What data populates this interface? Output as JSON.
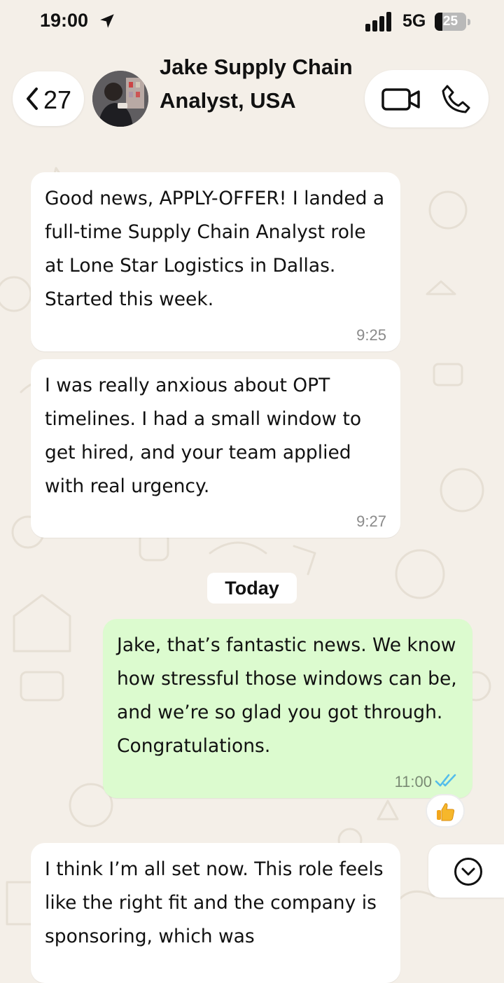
{
  "status_bar": {
    "time": "19:00",
    "network": "5G",
    "battery_level": "25",
    "battery_fraction": 0.25
  },
  "header": {
    "back_count": "27",
    "contact_name": "Jake Supply Chain Analyst, USA"
  },
  "messages": [
    {
      "direction": "incoming",
      "text": "Good news, APPLY-OFFER! I landed a full-time Supply Chain Analyst role at Lone Star Logistics in Dallas. Started this week.",
      "time": "9:25"
    },
    {
      "direction": "incoming",
      "text": "I was really anxious about OPT timelines. I had a small window to get hired, and your team applied with real urgency.",
      "time": "9:27"
    },
    {
      "direction": "outgoing",
      "text": "Jake, that’s fantastic news. We know how stressful those windows can be, and we’re so glad you got through. Congratulations.",
      "time": "11:00",
      "reaction": "thumbs-up"
    },
    {
      "direction": "incoming",
      "text": "I think I’m all set now. This role feels like the right fit and the company is sponsoring, which was",
      "time": ""
    }
  ],
  "date_divider": "Today",
  "colors": {
    "background": "#f4efe8",
    "incoming_bubble": "#ffffff",
    "outgoing_bubble": "#dcfbcf",
    "read_ticks": "#53bdeb"
  },
  "icons": {
    "location": "location-arrow-icon",
    "signal": "signal-bars-icon",
    "back": "chevron-left-icon",
    "video": "video-camera-icon",
    "phone": "phone-icon",
    "read": "double-check-icon",
    "reaction": "thumbs-up-icon",
    "scroll": "chevron-down-circle-icon"
  }
}
